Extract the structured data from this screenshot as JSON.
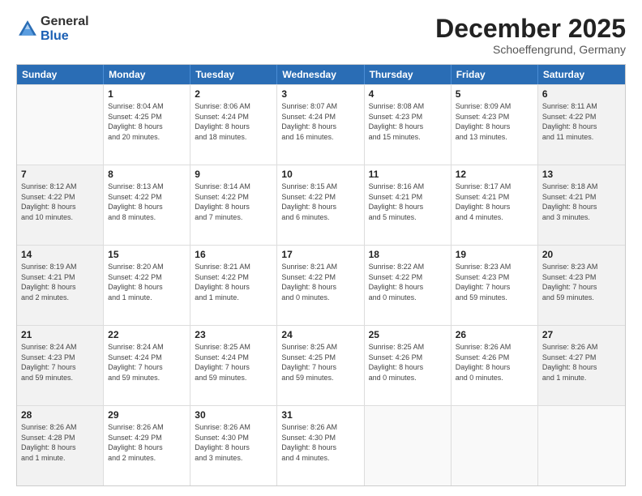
{
  "logo": {
    "general": "General",
    "blue": "Blue"
  },
  "title": "December 2025",
  "location": "Schoeffengrund, Germany",
  "weekdays": [
    "Sunday",
    "Monday",
    "Tuesday",
    "Wednesday",
    "Thursday",
    "Friday",
    "Saturday"
  ],
  "weeks": [
    [
      {
        "day": "",
        "info": ""
      },
      {
        "day": "1",
        "info": "Sunrise: 8:04 AM\nSunset: 4:25 PM\nDaylight: 8 hours\nand 20 minutes."
      },
      {
        "day": "2",
        "info": "Sunrise: 8:06 AM\nSunset: 4:24 PM\nDaylight: 8 hours\nand 18 minutes."
      },
      {
        "day": "3",
        "info": "Sunrise: 8:07 AM\nSunset: 4:24 PM\nDaylight: 8 hours\nand 16 minutes."
      },
      {
        "day": "4",
        "info": "Sunrise: 8:08 AM\nSunset: 4:23 PM\nDaylight: 8 hours\nand 15 minutes."
      },
      {
        "day": "5",
        "info": "Sunrise: 8:09 AM\nSunset: 4:23 PM\nDaylight: 8 hours\nand 13 minutes."
      },
      {
        "day": "6",
        "info": "Sunrise: 8:11 AM\nSunset: 4:22 PM\nDaylight: 8 hours\nand 11 minutes."
      }
    ],
    [
      {
        "day": "7",
        "info": "Sunrise: 8:12 AM\nSunset: 4:22 PM\nDaylight: 8 hours\nand 10 minutes."
      },
      {
        "day": "8",
        "info": "Sunrise: 8:13 AM\nSunset: 4:22 PM\nDaylight: 8 hours\nand 8 minutes."
      },
      {
        "day": "9",
        "info": "Sunrise: 8:14 AM\nSunset: 4:22 PM\nDaylight: 8 hours\nand 7 minutes."
      },
      {
        "day": "10",
        "info": "Sunrise: 8:15 AM\nSunset: 4:22 PM\nDaylight: 8 hours\nand 6 minutes."
      },
      {
        "day": "11",
        "info": "Sunrise: 8:16 AM\nSunset: 4:21 PM\nDaylight: 8 hours\nand 5 minutes."
      },
      {
        "day": "12",
        "info": "Sunrise: 8:17 AM\nSunset: 4:21 PM\nDaylight: 8 hours\nand 4 minutes."
      },
      {
        "day": "13",
        "info": "Sunrise: 8:18 AM\nSunset: 4:21 PM\nDaylight: 8 hours\nand 3 minutes."
      }
    ],
    [
      {
        "day": "14",
        "info": "Sunrise: 8:19 AM\nSunset: 4:21 PM\nDaylight: 8 hours\nand 2 minutes."
      },
      {
        "day": "15",
        "info": "Sunrise: 8:20 AM\nSunset: 4:22 PM\nDaylight: 8 hours\nand 1 minute."
      },
      {
        "day": "16",
        "info": "Sunrise: 8:21 AM\nSunset: 4:22 PM\nDaylight: 8 hours\nand 1 minute."
      },
      {
        "day": "17",
        "info": "Sunrise: 8:21 AM\nSunset: 4:22 PM\nDaylight: 8 hours\nand 0 minutes."
      },
      {
        "day": "18",
        "info": "Sunrise: 8:22 AM\nSunset: 4:22 PM\nDaylight: 8 hours\nand 0 minutes."
      },
      {
        "day": "19",
        "info": "Sunrise: 8:23 AM\nSunset: 4:23 PM\nDaylight: 7 hours\nand 59 minutes."
      },
      {
        "day": "20",
        "info": "Sunrise: 8:23 AM\nSunset: 4:23 PM\nDaylight: 7 hours\nand 59 minutes."
      }
    ],
    [
      {
        "day": "21",
        "info": "Sunrise: 8:24 AM\nSunset: 4:23 PM\nDaylight: 7 hours\nand 59 minutes."
      },
      {
        "day": "22",
        "info": "Sunrise: 8:24 AM\nSunset: 4:24 PM\nDaylight: 7 hours\nand 59 minutes."
      },
      {
        "day": "23",
        "info": "Sunrise: 8:25 AM\nSunset: 4:24 PM\nDaylight: 7 hours\nand 59 minutes."
      },
      {
        "day": "24",
        "info": "Sunrise: 8:25 AM\nSunset: 4:25 PM\nDaylight: 7 hours\nand 59 minutes."
      },
      {
        "day": "25",
        "info": "Sunrise: 8:25 AM\nSunset: 4:26 PM\nDaylight: 8 hours\nand 0 minutes."
      },
      {
        "day": "26",
        "info": "Sunrise: 8:26 AM\nSunset: 4:26 PM\nDaylight: 8 hours\nand 0 minutes."
      },
      {
        "day": "27",
        "info": "Sunrise: 8:26 AM\nSunset: 4:27 PM\nDaylight: 8 hours\nand 1 minute."
      }
    ],
    [
      {
        "day": "28",
        "info": "Sunrise: 8:26 AM\nSunset: 4:28 PM\nDaylight: 8 hours\nand 1 minute."
      },
      {
        "day": "29",
        "info": "Sunrise: 8:26 AM\nSunset: 4:29 PM\nDaylight: 8 hours\nand 2 minutes."
      },
      {
        "day": "30",
        "info": "Sunrise: 8:26 AM\nSunset: 4:30 PM\nDaylight: 8 hours\nand 3 minutes."
      },
      {
        "day": "31",
        "info": "Sunrise: 8:26 AM\nSunset: 4:30 PM\nDaylight: 8 hours\nand 4 minutes."
      },
      {
        "day": "",
        "info": ""
      },
      {
        "day": "",
        "info": ""
      },
      {
        "day": "",
        "info": ""
      }
    ]
  ]
}
